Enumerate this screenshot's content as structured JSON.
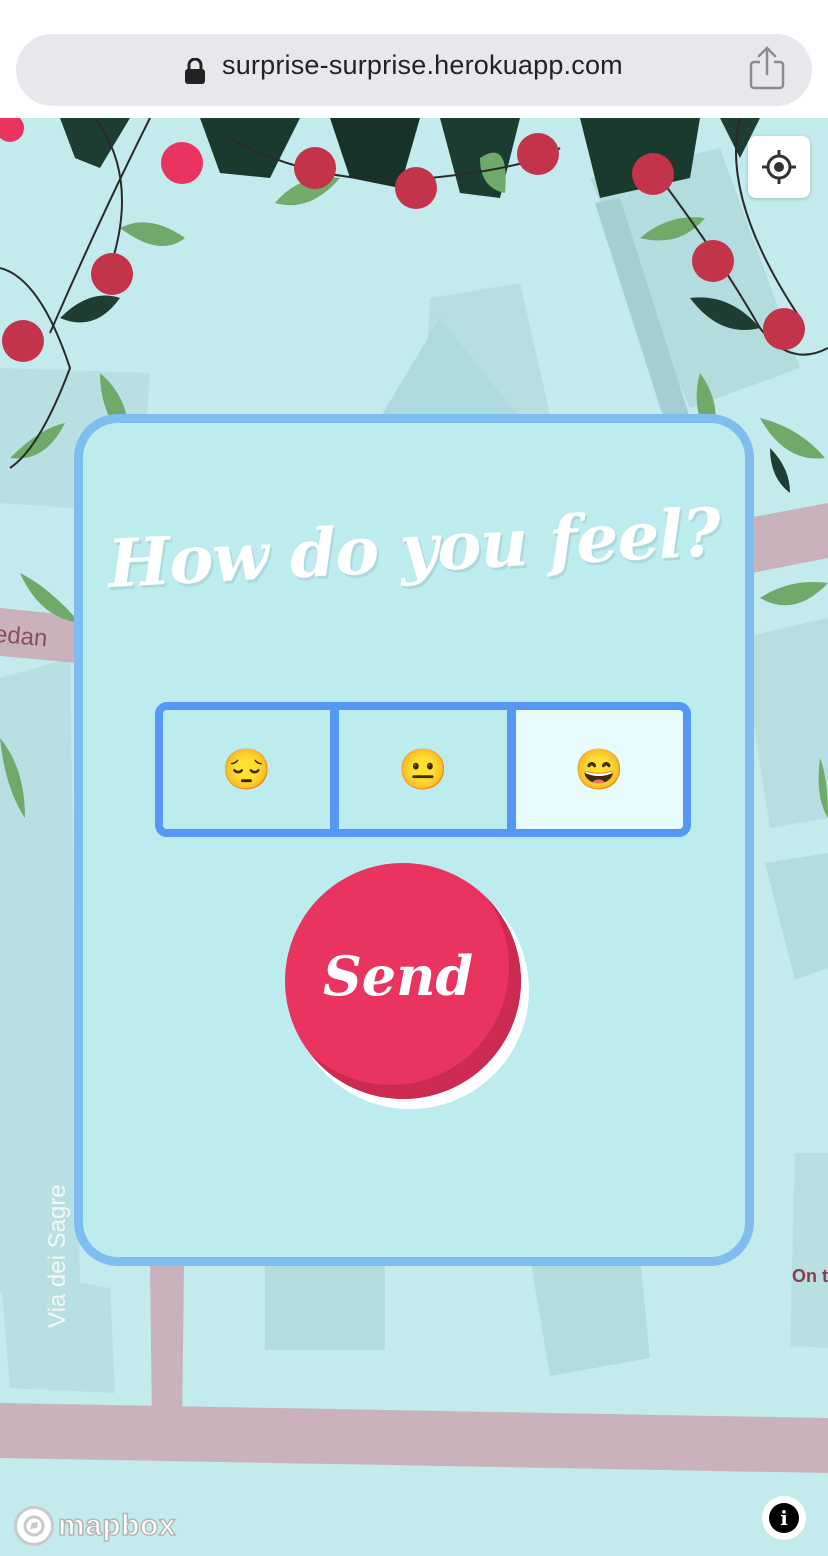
{
  "browser": {
    "url": "surprise-surprise.herokuapp.com",
    "lock_icon": "lock-icon",
    "share_icon": "share-icon"
  },
  "map": {
    "road_labels": {
      "left": "edan",
      "via": "Via dei Sagre",
      "right": "On t"
    },
    "locate_icon": "locate-icon",
    "attribution_logo": "mapbox",
    "info_icon": "i",
    "colors": {
      "water": "#c3ebee",
      "building": "#b7dfe2",
      "road": "#c9b2bb"
    }
  },
  "card": {
    "title": "How do you feel?",
    "moods": [
      {
        "label": "😔",
        "icon": "pensive-face-icon",
        "selected": false
      },
      {
        "label": "😐",
        "icon": "neutral-face-icon",
        "selected": false
      },
      {
        "label": "😄",
        "icon": "grinning-face-icon",
        "selected": true
      }
    ],
    "send_label": "Send",
    "colors": {
      "border": "#7fbcf0",
      "mood_border": "#5597f4",
      "send": "#e8345f"
    }
  }
}
